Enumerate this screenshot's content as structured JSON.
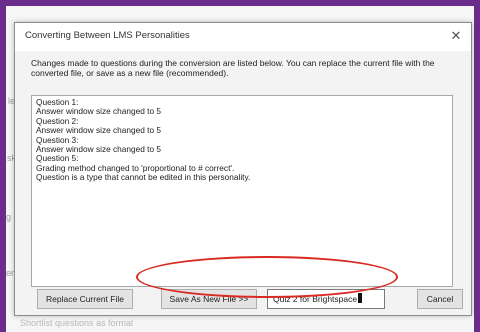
{
  "window": {
    "title": "Converting Between LMS Personalities",
    "close_glyph": "✕"
  },
  "description": "Changes made to questions during the conversion are listed below.  You can replace the current file with the converted file, or save as a new file (recommended).",
  "log_lines": [
    "Question 1:",
    "Answer window size changed to 5",
    "Question 2:",
    "Answer window size changed to 5",
    "Question 3:",
    "Answer window size changed to 5",
    "Question 5:",
    "Grading method changed to 'proportional to # correct'.",
    "Question is a type that cannot be edited in this personality."
  ],
  "buttons": {
    "replace": "Replace Current File",
    "save_as": "Save As New File >>",
    "cancel": "Cancel"
  },
  "filename_input": {
    "value": "Quiz 2 for Brightspace"
  },
  "background_fragments": {
    "left": [
      "le",
      "sk",
      "g i",
      "er"
    ],
    "bottom": "Shortlist questions as formal"
  },
  "annotation": {
    "color": "#d92b23"
  },
  "colors": {
    "frame": "#6b2d8c"
  }
}
